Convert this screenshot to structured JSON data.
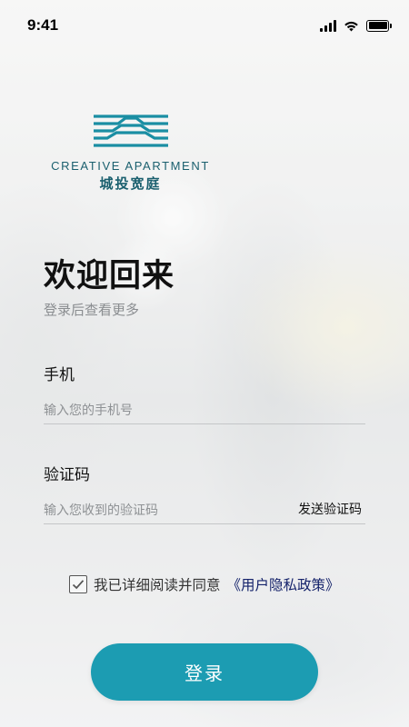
{
  "status_bar": {
    "time": "9:41",
    "icons": [
      "signal-icon",
      "wifi-icon",
      "battery-icon"
    ]
  },
  "logo": {
    "en": "CREATIVE APARTMENT",
    "cn": "城投宽庭",
    "icon": "building-logo-icon",
    "color": "#1a5f6e"
  },
  "welcome": {
    "title": "欢迎回来",
    "subtitle": "登录后查看更多"
  },
  "phone": {
    "label": "手机",
    "placeholder": "输入您的手机号",
    "value": ""
  },
  "code": {
    "label": "验证码",
    "placeholder": "输入您收到的验证码",
    "value": "",
    "send_label": "发送验证码"
  },
  "agreement": {
    "text": "我已详细阅读并同意",
    "link": "《用户隐私政策》",
    "checked": true,
    "link_color": "#15236b"
  },
  "login_button": {
    "label": "登录",
    "color": "#1c9cb2"
  }
}
